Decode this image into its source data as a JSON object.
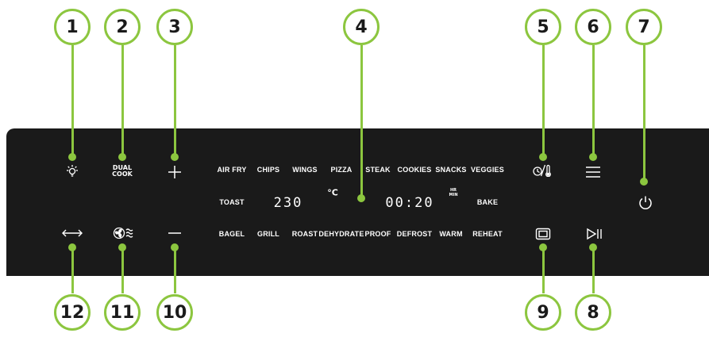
{
  "colors": {
    "panel": "#1a1a1a",
    "accent": "#8cc63f",
    "text": "#ffffff",
    "badge_text": "#1a1a1a"
  },
  "callouts": [
    "1",
    "2",
    "3",
    "4",
    "5",
    "6",
    "7",
    "8",
    "9",
    "10",
    "11",
    "12"
  ],
  "buttons": {
    "light": {
      "icon": "light-bulb-icon"
    },
    "dual_cook": {
      "line1": "DUAL",
      "line2": "COOK"
    },
    "plus": {
      "icon": "plus-icon"
    },
    "timer_temp": {
      "icon": "timer-thermometer-icon"
    },
    "menu": {
      "icon": "menu-icon"
    },
    "power": {
      "icon": "power-icon"
    },
    "start_pause": {
      "icon": "play-pause-icon"
    },
    "oven_window": {
      "icon": "oven-window-icon"
    },
    "minus": {
      "icon": "minus-icon"
    },
    "fan_speed": {
      "icon": "fan-speed-icon"
    },
    "sync": {
      "icon": "sync-arrows-icon"
    }
  },
  "modes": {
    "row1": [
      "AIR FRY",
      "CHIPS",
      "WINGS",
      "PIZZA",
      "STEAK",
      "COOKIES",
      "SNACKS",
      "VEGGIES"
    ],
    "row2_left": "TOAST",
    "row2_right": "BAKE",
    "row3": [
      "BAGEL",
      "GRILL",
      "ROAST",
      "DEHYDRATE",
      "PROOF",
      "DEFROST",
      "WARM",
      "REHEAT"
    ]
  },
  "display": {
    "temperature": "230",
    "temp_unit": "°C",
    "time": "00:20",
    "time_unit_top": "HR",
    "time_unit_bottom": "MIN"
  }
}
